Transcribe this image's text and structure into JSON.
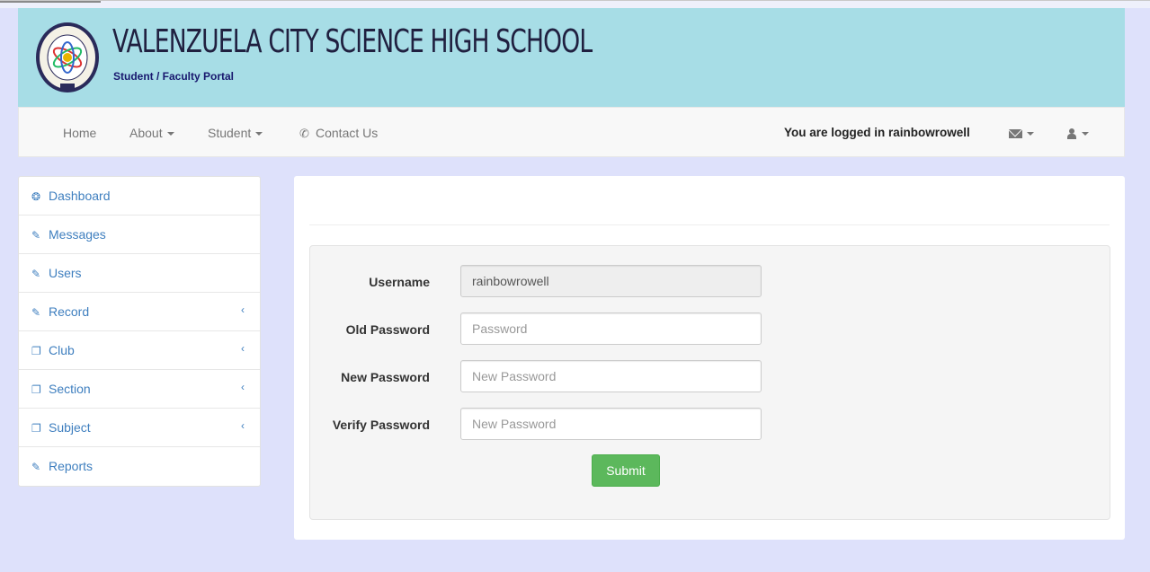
{
  "header": {
    "school_name": "VALENZUELA CITY SCIENCE HIGH SCHOOL",
    "portal_label": "Student / Faculty Portal",
    "logo_icon": "school-seal-icon"
  },
  "navbar": {
    "home": "Home",
    "about": "About",
    "student": "Student",
    "contact": "Contact Us",
    "logged_in_text": "You are logged in rainbowrowell",
    "messages_icon": "envelope-icon",
    "user_icon": "user-icon"
  },
  "sidebar": {
    "items": [
      {
        "label": "Dashboard",
        "icon": "dashboard-icon"
      },
      {
        "label": "Messages",
        "icon": "edit-icon"
      },
      {
        "label": "Users",
        "icon": "edit-icon"
      },
      {
        "label": "Record",
        "icon": "edit-icon"
      },
      {
        "label": "Club",
        "icon": "copy-icon"
      },
      {
        "label": "Section",
        "icon": "copy-icon"
      },
      {
        "label": "Subject",
        "icon": "copy-icon"
      },
      {
        "label": "Reports",
        "icon": "edit-icon"
      }
    ]
  },
  "form": {
    "username_label": "Username",
    "username_value": "rainbowrowell",
    "old_password_label": "Old Password",
    "old_password_placeholder": "Password",
    "new_password_label": "New Password",
    "new_password_placeholder": "New Password",
    "verify_password_label": "Verify Password",
    "verify_password_placeholder": "New Password",
    "submit_label": "Submit"
  },
  "colors": {
    "banner": "#a7dde6",
    "page_background": "#dee1fb",
    "link": "#3f7fbf",
    "submit": "#5cb85c"
  }
}
